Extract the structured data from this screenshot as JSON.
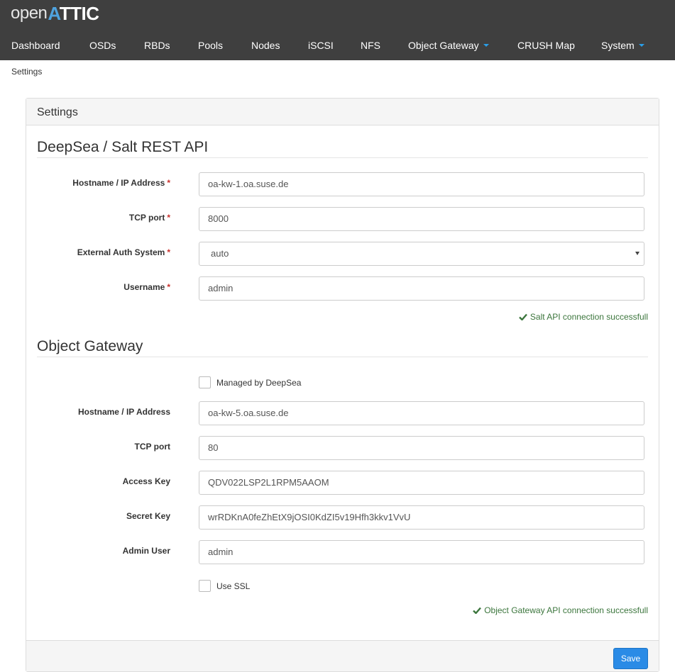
{
  "logo": {
    "open": "open",
    "attic_first": "A",
    "attic_rest": "TTIC"
  },
  "nav": {
    "items": [
      {
        "label": "Dashboard"
      },
      {
        "label": "OSDs"
      },
      {
        "label": "RBDs"
      },
      {
        "label": "Pools"
      },
      {
        "label": "Nodes"
      },
      {
        "label": "iSCSI"
      },
      {
        "label": "NFS"
      },
      {
        "label": "Object Gateway"
      },
      {
        "label": "CRUSH Map"
      },
      {
        "label": "System"
      }
    ]
  },
  "breadcrumb": "Settings",
  "panel": {
    "title": "Settings",
    "deepsea": {
      "title": "DeepSea / Salt REST API",
      "hostname": {
        "label": "Hostname / IP Address",
        "required": "*",
        "value": "oa-kw-1.oa.suse.de"
      },
      "tcp_port": {
        "label": "TCP port",
        "required": "*",
        "value": "8000"
      },
      "auth_system": {
        "label": "External Auth System",
        "required": "*",
        "value": "auto"
      },
      "username": {
        "label": "Username",
        "required": "*",
        "value": "admin"
      },
      "status": "Salt API connection successfull"
    },
    "rgw": {
      "title": "Object Gateway",
      "managed_by_deepsea": {
        "label": "Managed by DeepSea",
        "checked": false
      },
      "hostname": {
        "label": "Hostname / IP Address",
        "value": "oa-kw-5.oa.suse.de"
      },
      "tcp_port": {
        "label": "TCP port",
        "value": "80"
      },
      "access_key": {
        "label": "Access Key",
        "value": "QDV022LSP2L1RPM5AAOM"
      },
      "secret_key": {
        "label": "Secret Key",
        "value": "wrRDKnA0feZhEtX9jOSI0KdZI5v19Hfh3kkv1VvU"
      },
      "admin_user": {
        "label": "Admin User",
        "value": "admin"
      },
      "use_ssl": {
        "label": "Use SSL",
        "checked": false
      },
      "status": "Object Gateway API connection successfull"
    },
    "save_label": "Save"
  },
  "colors": {
    "navbar_bg": "#3f3f3f",
    "accent": "#2a8be6",
    "success": "#3c763d",
    "required": "#c9302c"
  }
}
